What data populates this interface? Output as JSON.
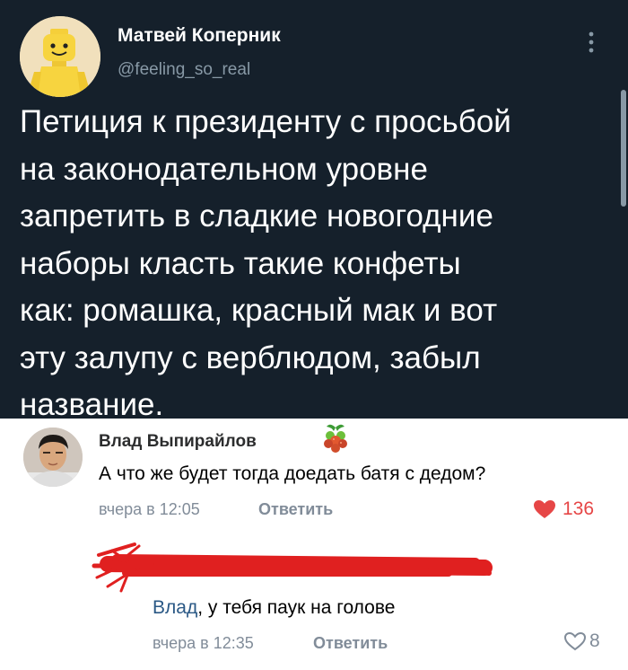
{
  "tweet": {
    "author_name": "Матвей Коперник",
    "handle": "@feeling_so_real",
    "text": "Петиция к президенту с просьбой\nна законодательном уровне\nзапретить в сладкие новогодние\nнаборы класть такие конфеты\nкак: ромашка, красный мак и вот\nэту залупу с верблюдом, забыл\nназвание.",
    "avatar_icon": "lego-figure-avatar",
    "menu_icon": "vertical-dots-icon"
  },
  "comments": [
    {
      "author": "Влад Выпирайлов",
      "badge_icon": "raspberry-badge-icon",
      "text": "А что же будет тогда доедать батя с дедом?",
      "time": "вчера в 12:05",
      "reply_label": "Ответить",
      "likes": "136",
      "liked": true
    },
    {
      "author_hidden_by": "red-scribble",
      "mention": "Влад",
      "text": ", у тебя паук на голове",
      "time": "вчера в 12:35",
      "reply_label": "Ответить",
      "likes": "8",
      "liked": false
    }
  ],
  "colors": {
    "tweet_bg": "#15202b",
    "tweet_text": "#ffffff",
    "handle": "#8899a6",
    "like_active": "#e64646",
    "meta": "#818c99",
    "link": "#2a5885",
    "scribble": "#e02020"
  }
}
